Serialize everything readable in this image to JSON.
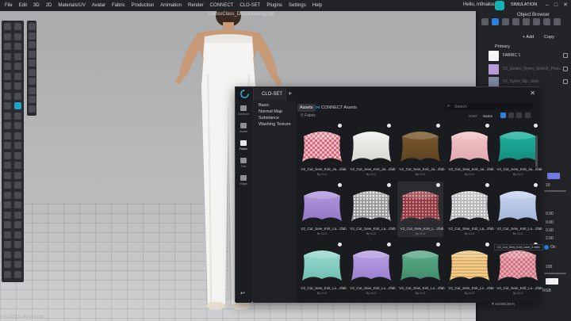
{
  "menubar": {
    "items": [
      "File",
      "Edit",
      "3D",
      "2D",
      "Materials/UV",
      "Avatar",
      "Fabric",
      "Production",
      "Animation",
      "Render",
      "CONNECT",
      "CLO-SET",
      "Plugins",
      "Settings",
      "Help"
    ],
    "greeting": "Hello, m9naksu",
    "mode": "SIMULATION"
  },
  "document": {
    "title": "ColossClass_DigitalSewing.zprj"
  },
  "statusbar": {
    "text": "ion 2025.0.148 (r54218)"
  },
  "object_browser": {
    "title": "Object Browser",
    "add_label": "+ Add",
    "copy_label": "Copy",
    "primary_label": "Primary",
    "fabrics": [
      {
        "label": "FABRIC 1",
        "color": "#f5f5f5"
      },
      {
        "label": "V2_Gelato_Nylon_Stretch_Plain...",
        "color": "#b79ad9"
      },
      {
        "label": "V2_Nylon_Rip_Stop",
        "color": "#7e8aa6"
      }
    ],
    "props": {
      "p1": "10",
      "p2": "0.00",
      "p3": "0.00",
      "p4": "0.00",
      "p5": "2.00",
      "on_label": "On",
      "p6": "100",
      "rgb_label": "RGB",
      "reflection_label": "Reflection"
    }
  },
  "closet": {
    "title": "CLO-SET",
    "sidebar": [
      {
        "label": "Garment"
      },
      {
        "label": "Avatar"
      },
      {
        "label": "Fabric"
      },
      {
        "label": "Trim"
      },
      {
        "label": "Stage"
      }
    ],
    "categories": [
      "Basic",
      "Normal Map",
      "Substance",
      "Washing Texture"
    ],
    "tabs": {
      "assets": "Assets",
      "connect": "CONNECT Assets"
    },
    "search_placeholder": "Search",
    "filter_label": "Fabric",
    "sort_label": "SORT",
    "sort_value": "Name",
    "assets": [
      {
        "name": "V2_Cut_Sew_Knit_Ja...zfab",
        "by": "By CLO",
        "c1": "#d9667a",
        "c2": "#f1c1c6",
        "pattern": "check"
      },
      {
        "name": "V2_Cut_Sew_Knit_Ja...zfab",
        "by": "By CLO",
        "c1": "#f1f1ee",
        "c2": "#d9d9d4",
        "pattern": "plain"
      },
      {
        "name": "V2_Cut_Sew_Knit_Ja...zfab",
        "by": "By CLO",
        "c1": "#7b5a2e",
        "c2": "#5e4322",
        "pattern": "plain"
      },
      {
        "name": "V2_Cut_Sew_Knit_Ja...zfab",
        "by": "By CLO",
        "c1": "#f3c5c8",
        "c2": "#e1a9ae",
        "pattern": "plain"
      },
      {
        "name": "V2_Cut_Sew_Knit_Ja...zfab",
        "by": "By CLO",
        "c1": "#1fb5a0",
        "c2": "#148a7a",
        "pattern": "plain"
      },
      {
        "name": "V2_Cut_Sew_Knit_La...zfab",
        "by": "By CLO",
        "c1": "#b59ade",
        "c2": "#9276c6",
        "pattern": "plain"
      },
      {
        "name": "V2_Cut_Sew_Knit_La...zfab",
        "by": "By CLO",
        "c1": "#e8e8e8",
        "c2": "#9a9a9a",
        "pattern": "lace"
      },
      {
        "name": "V2_Cut_Sew_Knit_L...zfab",
        "by": "By CLO",
        "c1": "#d68a8f",
        "c2": "#8e3a44",
        "pattern": "lace"
      },
      {
        "name": "V2_Cut_Sew_Knit_La...zfab",
        "by": "By CLO",
        "c1": "#f0f0f0",
        "c2": "#b7b7b7",
        "pattern": "lace"
      },
      {
        "name": "V2_Cut_Sew_Knit_Lo...zfab",
        "by": "By CLO",
        "c1": "#c9d6f0",
        "c2": "#a3b4d8",
        "pattern": "plain"
      },
      {
        "name": "V2_Cut_Sew_Knit_Lo...zfab",
        "by": "By CLO",
        "c1": "#9ad9cf",
        "c2": "#6fbfb2",
        "pattern": "plain"
      },
      {
        "name": "V2_Cut_Sew_Knit_Lo...zfab",
        "by": "By CLO",
        "c1": "#b9a2e3",
        "c2": "#9b7fd0",
        "pattern": "plain"
      },
      {
        "name": "V2_Cut_Sew_Knit_Lo...zfab",
        "by": "By CLO",
        "c1": "#5fae8c",
        "c2": "#3f8a6a",
        "pattern": "plain"
      },
      {
        "name": "V2_Cut_Sew_Knit_Lo...zfab",
        "by": "By CLO",
        "c1": "#f2cc8b",
        "c2": "#d6a862",
        "pattern": "stripe"
      },
      {
        "name": "V2_Cut_Sew_Knit_Lo...zfab",
        "by": "By CLO",
        "c1": "#f0a3ae",
        "c2": "#c77884",
        "pattern": "check"
      }
    ],
    "tooltip": "V2_Cut_Sew_Knit_Lace_2.zfab"
  }
}
